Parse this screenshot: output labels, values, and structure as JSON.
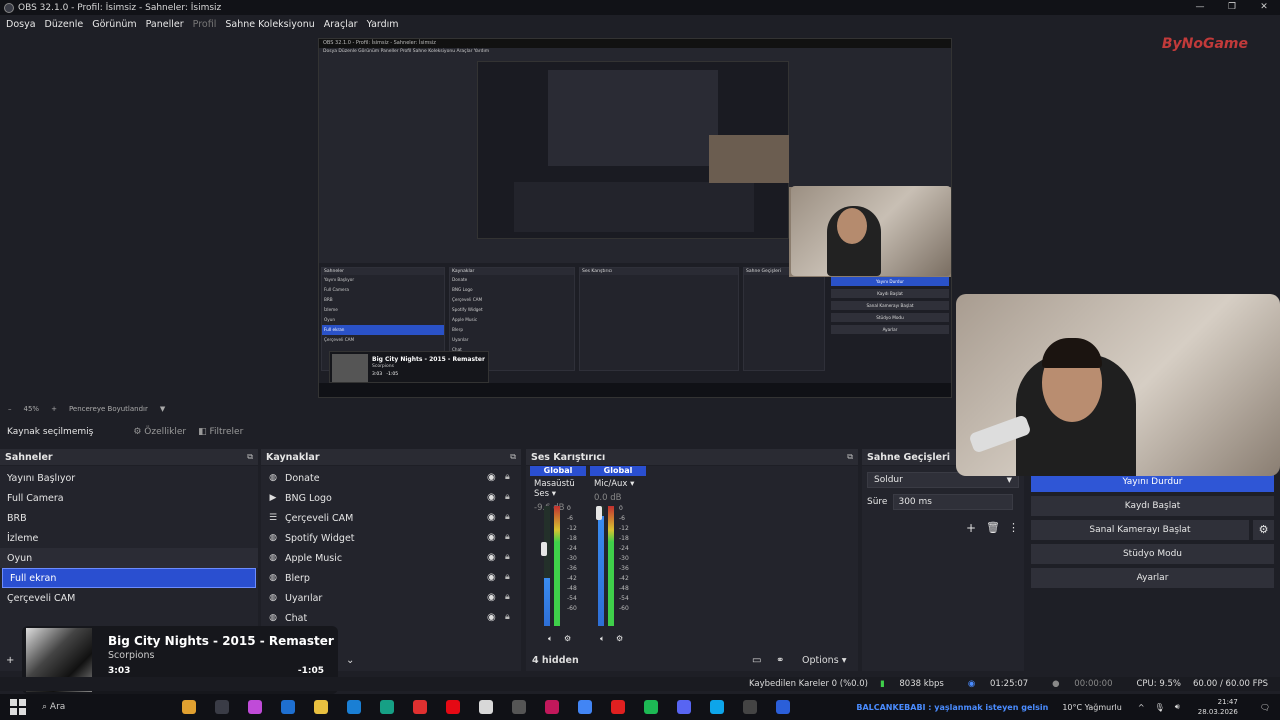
{
  "window": {
    "title": "OBS 32.1.0 - Profil: İsimsiz - Sahneler: İsimsiz",
    "controls": [
      "—",
      "❐",
      "✕"
    ]
  },
  "menu": [
    "Dosya",
    "Düzenle",
    "Görünüm",
    "Paneller",
    "Profil",
    "Sahne Koleksiyonu",
    "Araçlar",
    "Yardım"
  ],
  "preview": {
    "brand_logo": "ByNoGame",
    "nested_title": "OBS 32.1.0 - Profil: İsimsiz - Sahneler: İsimsiz",
    "nested_menu": "Dosya  Düzenle  Görünüm  Paneller  Profil  Sahne Koleksiyonu  Araçlar  Yardım",
    "nested_panels": {
      "scenes_title": "Sahneler",
      "sources_title": "Kaynaklar",
      "mixer_title": "Ses Karıştırıcı",
      "trans_title": "Sahne Geçişleri",
      "scenes": [
        "Yayını Başlıyor",
        "Full Camera",
        "BRB",
        "İzleme",
        "Oyun",
        "Full ekran",
        "Çerçeveli CAM"
      ],
      "sources": [
        "Donate",
        "BNG Logo",
        "Çerçeveli CAM",
        "Spotify Widget",
        "Apple Music",
        "Blerp",
        "Uyarılar",
        "Chat"
      ],
      "buttons": [
        "Yayını Durdur",
        "Kaydı Başlat",
        "Sanal Kamerayı Başlat",
        "Stüdyo Modu",
        "Ayarlar"
      ],
      "music_title": "Big City Nights - 2015 - Remaster",
      "music_artist": "Scorpions",
      "music_pos": "3:03",
      "music_rem": "-1:05"
    }
  },
  "zoom": {
    "percent": "45%",
    "resize": "Pencereye Boyutlandır"
  },
  "source_bar": {
    "label": "Kaynak seçilmemiş",
    "props": "Özellikler",
    "filters": "Filtreler"
  },
  "scenes": {
    "title": "Sahneler",
    "items": [
      "Yayını Başlıyor",
      "Full Camera",
      "BRB",
      "İzleme",
      "Oyun",
      "Full ekran",
      "Çerçeveli CAM"
    ],
    "selected_index": 5
  },
  "sources": {
    "title": "Kaynaklar",
    "items": [
      {
        "label": "Donate",
        "icon": "globe-icon"
      },
      {
        "label": "BNG Logo",
        "icon": "play-icon"
      },
      {
        "label": "Çerçeveli CAM",
        "icon": "list-icon"
      },
      {
        "label": "Spotify Widget",
        "icon": "globe-icon"
      },
      {
        "label": "Apple Music",
        "icon": "globe-icon"
      },
      {
        "label": "Blerp",
        "icon": "globe-icon"
      },
      {
        "label": "Uyarılar",
        "icon": "globe-icon"
      },
      {
        "label": "Chat",
        "icon": "globe-icon"
      }
    ]
  },
  "mixer": {
    "title": "Ses Karıştırıcı",
    "channels": [
      {
        "head": "Global",
        "name": "Masaüstü Ses",
        "db": "-9.6 dB"
      },
      {
        "head": "Global",
        "name": "Mic/Aux",
        "db": "0.0 dB"
      }
    ],
    "scale": [
      "0",
      "-6",
      "-12",
      "-18",
      "-24",
      "-30",
      "-36",
      "-42",
      "-48",
      "-54",
      "-60"
    ],
    "hidden": "4 hidden",
    "options": "Options"
  },
  "transitions": {
    "title": "Sahne Geçişleri",
    "type": "Soldur",
    "duration_label": "Süre",
    "duration": "300 ms"
  },
  "controls": {
    "buttons": [
      "Yayını Durdur",
      "Kaydı Başlat",
      "Sanal Kamerayı Başlat",
      "Stüdyo Modu",
      "Ayarlar"
    ]
  },
  "music": {
    "title": "Big City Nights - 2015 - Remaster",
    "artist": "Scorpions",
    "position": "3:03",
    "remaining": "-1:05",
    "progress": 0.74
  },
  "status": {
    "dropped": "Kaybedilen Kareler 0 (%0.0)",
    "bitrate": "8038 kbps",
    "live": "01:25:07",
    "rec": "00:00:00",
    "cpu": "CPU: 9.5%",
    "fps": "60.00 / 60.00 FPS"
  },
  "taskbar": {
    "search": "Ara",
    "marquee": "BALCANKEBABI : yaşlanmak isteyen gelsin",
    "weather": "10°C  Yağmurlu",
    "time": "21:47",
    "date": "28.03.2026",
    "colors": [
      "#e0a030",
      "#3a3c46",
      "#c04bd8",
      "#1e6fd0",
      "#e8c040",
      "#1a7fd4",
      "#16a085",
      "#e03030",
      "#e50914",
      "#d8d8d8",
      "#555",
      "#c2185b",
      "#4285f4",
      "#e02020",
      "#1db954",
      "#5865f2",
      "#0ea5e9",
      "#444",
      "#2b5fd9"
    ]
  }
}
